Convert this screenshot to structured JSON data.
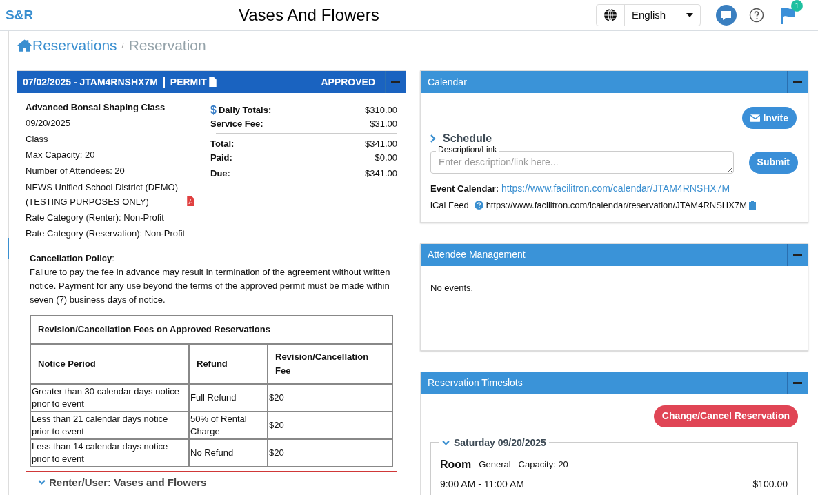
{
  "header": {
    "logo": "S&R",
    "title": "Vases And Flowers",
    "language": "English",
    "notification_count": "1"
  },
  "breadcrumb": [
    {
      "label": "Reservations",
      "kind": "link"
    },
    {
      "label": "/",
      "kind": "separator"
    },
    {
      "label": "Reservation",
      "kind": "current"
    }
  ],
  "reservation": {
    "title": "07/02/2025 - JTAM4RNSHX7M",
    "permit": "PERMIT",
    "status": "APPROVED",
    "details": [
      {
        "text": "Advanced Bonsai Shaping Class",
        "kind": "title"
      },
      {
        "text": "09/20/2025",
        "kind": "plain"
      },
      {
        "text": "Class",
        "kind": "plain"
      },
      {
        "text": "Max Capacity: 20",
        "kind": "plain"
      },
      {
        "text": "Number of Attendees: 20",
        "kind": "plain"
      },
      {
        "text": "NEWS Unified School District (DEMO) (TESTING PURPOSES ONLY)",
        "kind": "document"
      },
      {
        "text": "Rate Category (Renter): Non-Profit",
        "kind": "plain"
      },
      {
        "text": "Rate Category (Reservation): Non-Profit",
        "kind": "plain"
      }
    ],
    "totals": [
      {
        "label": "Daily Totals:",
        "value": "$310.00",
        "kind": "daily",
        "icon": "$"
      },
      {
        "label": "Service Fee:",
        "value": "$31.00",
        "kind": "subtotal"
      },
      {
        "label": "Total:",
        "value": "$341.00",
        "kind": "total"
      },
      {
        "label": "Paid:",
        "value": "$0.00",
        "kind": "plain"
      },
      {
        "label": "Due:",
        "value": "$341.00",
        "kind": "plain"
      }
    ],
    "policy": {
      "title": "Cancellation Policy",
      "title_suffix": ":",
      "text": "Failure to pay the fee in advance may result in termination of the agreement without written notice. Payment for any use beyond the terms of the approved permit must be made within seven (7) business days of notice."
    },
    "fees_table": {
      "title": "Revision/Cancellation Fees on Approved Reservations",
      "columns": [
        "Notice Period",
        "Refund",
        "Revision/Cancellation Fee"
      ],
      "rows": [
        [
          "Greater than 30 calendar days notice prior to event",
          "Full Refund",
          "$20"
        ],
        [
          "Less than 21 calendar days notice prior to event",
          "50% of Rental Charge",
          "$20"
        ],
        [
          "Less than 14 calendar days notice prior to event",
          "No Refund",
          "$20"
        ]
      ]
    },
    "renter": "Renter/User: Vases and Flowers"
  },
  "calendar": {
    "title": "Calendar",
    "invite": "Invite",
    "schedule": "Schedule",
    "schedule_expanded": false,
    "field_label": "Description/Link",
    "placeholder": "Enter description/link here...",
    "submit": "Submit",
    "event_calendar_label": "Event Calendar:",
    "event_calendar_url": "https://www.facilitron.com/calendar/JTAM4RNSHX7M",
    "ical_label": "iCal Feed",
    "ical_url": "https://www.facilitron.com/icalendar/reservation/JTAM4RNSHX7M"
  },
  "attendees": {
    "title": "Attendee Management",
    "empty": "No events."
  },
  "timeslots": {
    "title": "Reservation Timeslots",
    "change_button": "Change/Cancel Reservation",
    "day": {
      "label": "Saturday 09/20/2025",
      "expanded": true,
      "slot": {
        "room": "Room",
        "category": "General",
        "capacity": "Capacity: 20",
        "time": "9:00 AM - 11:00 AM",
        "price": "$100.00"
      }
    }
  }
}
